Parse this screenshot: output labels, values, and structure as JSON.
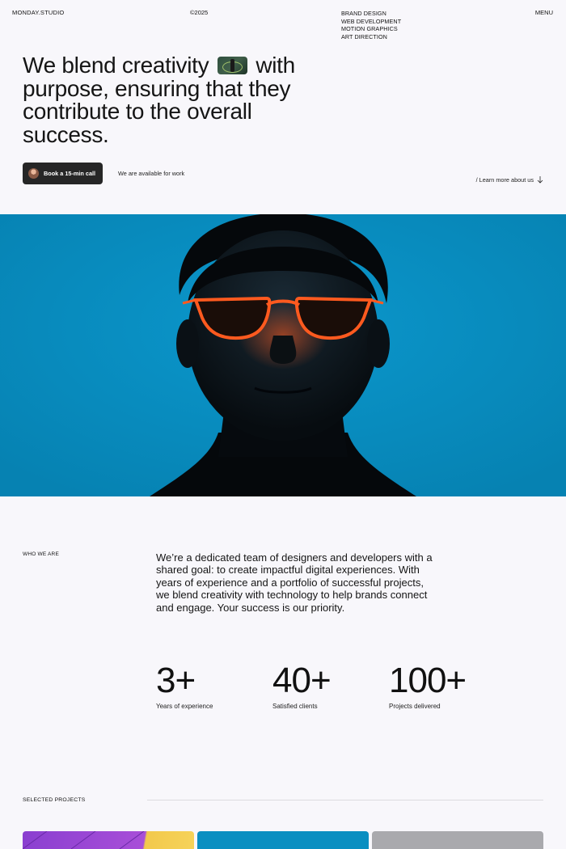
{
  "header": {
    "brand": "MONDAY.STUDIO",
    "year": "©2025",
    "services": [
      "BRAND DESIGN",
      "WEB DEVELOPMENT",
      "MOTION GRAPHICS",
      "ART DIRECTION"
    ],
    "menu_label": "MENU"
  },
  "hero": {
    "heading_before": "We blend creativity",
    "heading_after": "with purpose, ensuring that they contribute to the overall success.",
    "book_label": "Book a 15-min call",
    "availability": "We are available for work",
    "learn_more": "/ Learn more about us"
  },
  "about": {
    "label": "WHO WE ARE",
    "text": "We’re a dedicated team of designers and developers with a shared goal: to create impactful digital experiences. With years of experience and a portfolio of successful projects, we blend creativity with technology to help brands connect and engage. Your success is our priority."
  },
  "stats": [
    {
      "value": "3+",
      "caption": "Years of experience"
    },
    {
      "value": "40+",
      "caption": "Satisfied clients"
    },
    {
      "value": "100+",
      "caption": "Projects delivered"
    }
  ],
  "projects": {
    "label": "SELECTED PROJECTS"
  },
  "colors": {
    "background": "#f8f7fb",
    "hero_blue": "#0a8fc1",
    "button_dark": "#262626",
    "glasses_orange": "#ff5a1f"
  },
  "icons": {
    "learn_more": "arrow-down-icon"
  }
}
